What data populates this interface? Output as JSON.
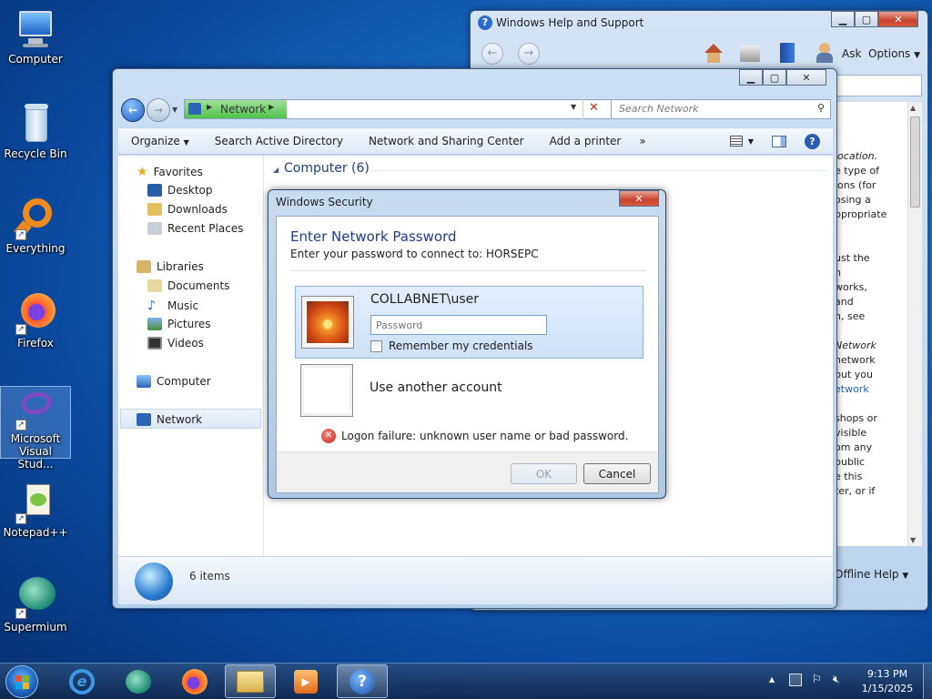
{
  "desktop": {
    "icons": [
      {
        "label": "Computer"
      },
      {
        "label": "Recycle Bin"
      },
      {
        "label": "Everything"
      },
      {
        "label": "Firefox"
      },
      {
        "label": "Microsoft Visual Stud..."
      },
      {
        "label": "Notepad++"
      },
      {
        "label": "Supermium"
      }
    ]
  },
  "help_window": {
    "title": "Windows Help and Support",
    "toolbar": {
      "ask": "Ask",
      "options": "Options"
    },
    "body_lines": [
      "location.",
      "e type of",
      "ions (for",
      "osing a",
      "ppropriate",
      "",
      "",
      "ust the",
      "n",
      "works,",
      "and",
      "n, see",
      "",
      "Network",
      "network",
      "but you",
      "etwork",
      "",
      "shops or",
      "visible",
      "om any",
      "public",
      "e this",
      "ter, or if"
    ],
    "footer": "Offline Help"
  },
  "explorer": {
    "address": "Network",
    "search_placeholder": "Search Network",
    "toolbar": {
      "organize": "Organize",
      "search_ad": "Search Active Directory",
      "network_sharing": "Network and Sharing Center",
      "add_printer": "Add a printer",
      "more": "»"
    },
    "nav": {
      "favorites": "Favorites",
      "desktop": "Desktop",
      "downloads": "Downloads",
      "recent": "Recent Places",
      "libraries": "Libraries",
      "documents": "Documents",
      "music": "Music",
      "pictures": "Pictures",
      "videos": "Videos",
      "computer": "Computer",
      "network": "Network"
    },
    "group_header": "Computer (6)",
    "status": "6 items"
  },
  "dialog": {
    "title": "Windows Security",
    "heading": "Enter Network Password",
    "subheading": "Enter your password to connect to: HORSEPC",
    "account_name": "COLLABNET\\user",
    "password_placeholder": "Password",
    "remember_label": "Remember my credentials",
    "other_account": "Use another account",
    "error": "Logon failure: unknown user name or bad password.",
    "ok": "OK",
    "cancel": "Cancel"
  },
  "taskbar": {
    "time": "9:13 PM",
    "date": "1/15/2025"
  }
}
